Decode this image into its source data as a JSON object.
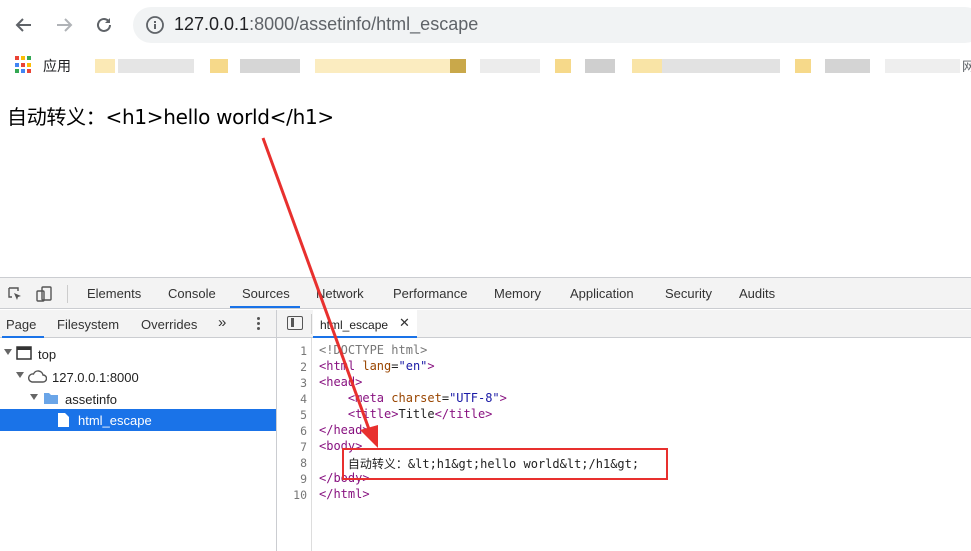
{
  "browser": {
    "url_host": "127.0.0.1",
    "url_path": ":8000/assetinfo/html_escape"
  },
  "bookmarks": {
    "apps_label": "应用",
    "trailing_char": "网"
  },
  "page": {
    "text": "自动转义：<h1>hello world</h1>"
  },
  "devtools": {
    "tabs": [
      "Elements",
      "Console",
      "Sources",
      "Network",
      "Performance",
      "Memory",
      "Application",
      "Security",
      "Audits"
    ],
    "active_tab": "Sources",
    "navigator_tabs": [
      "Page",
      "Filesystem",
      "Overrides"
    ],
    "navigator_more": "»",
    "tree": [
      {
        "label": "top"
      },
      {
        "label": "127.0.0.1:8000"
      },
      {
        "label": "assetinfo"
      },
      {
        "label": "html_escape"
      }
    ],
    "editor_file_tab": "html_escape",
    "editor_close": "✕",
    "line_numbers": [
      "1",
      "2",
      "3",
      "4",
      "5",
      "6",
      "7",
      "8",
      "9",
      "10"
    ]
  },
  "colors": {
    "accent": "#1a73e8",
    "annotation_red": "#e8302e",
    "tag": "#881280",
    "attr": "#994500",
    "value": "#1a1aa6"
  }
}
